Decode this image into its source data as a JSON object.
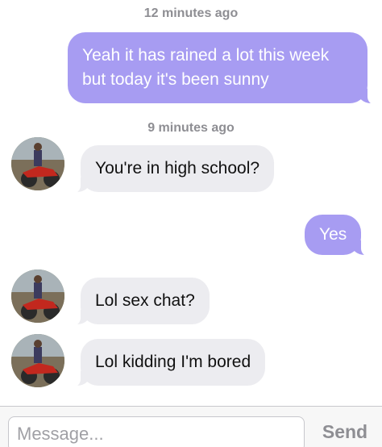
{
  "messages": [
    {
      "timestamp": "12 minutes ago"
    },
    {
      "direction": "outgoing",
      "text": "Yeah it has rained a lot this week but today it's been sunny"
    },
    {
      "timestamp": "9 minutes ago"
    },
    {
      "direction": "incoming",
      "text": "You're in high school?"
    },
    {
      "direction": "outgoing",
      "text": "Yes"
    },
    {
      "direction": "incoming",
      "text": "Lol sex chat?"
    },
    {
      "direction": "incoming",
      "text": "Lol kidding I'm bored"
    }
  ],
  "composer": {
    "placeholder": "Message...",
    "send_label": "Send"
  },
  "colors": {
    "outgoing_bubble": "#a79cf2",
    "incoming_bubble": "#ececf0",
    "timestamp": "#8e8e93"
  }
}
